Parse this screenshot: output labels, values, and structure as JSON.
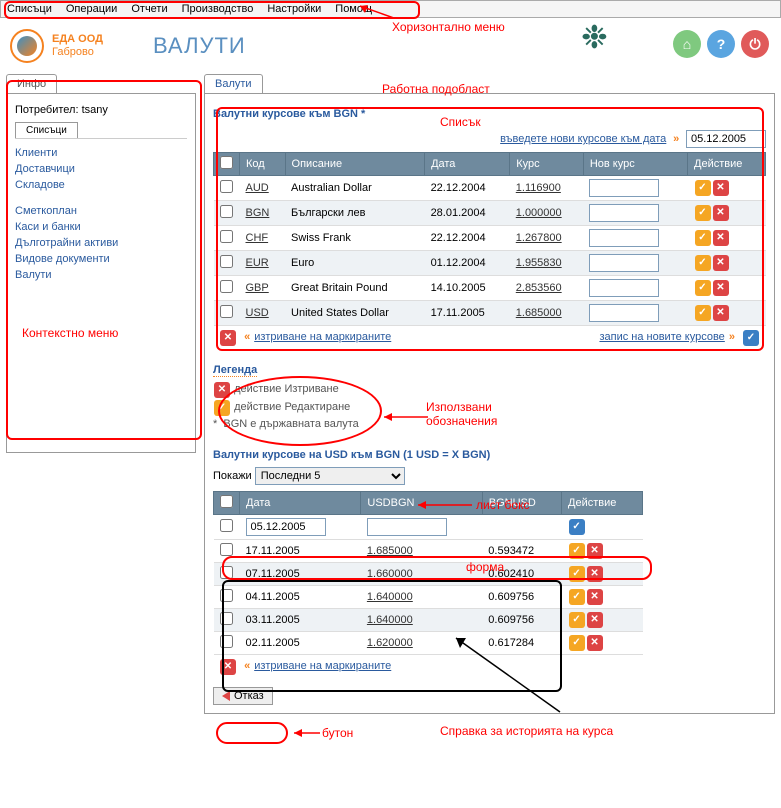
{
  "menu": {
    "items": [
      "Списъци",
      "Операции",
      "Отчети",
      "Производство",
      "Настройки",
      "Помощ"
    ]
  },
  "company": {
    "name": "ЕДА ООД",
    "city": "Габрово"
  },
  "page_title": "ВАЛУТИ",
  "annotations": {
    "horiz_menu": "Хоризонтално меню",
    "work_area": "Работна подобласт",
    "list": "Списък",
    "context_menu": "Контекстно меню",
    "used_legend_1": "Използвани",
    "used_legend_2": "обозначения",
    "listbox": "лист бокс",
    "form": "форма",
    "button": "бутон",
    "history": "Справка за историята на курса"
  },
  "left": {
    "tab": "Инфо",
    "user_label": "Потребител:",
    "user": "tsany",
    "subtab": "Списъци",
    "items1": [
      "Клиенти",
      "Доставчици",
      "Складове"
    ],
    "items2": [
      "Сметкоплан",
      "Каси и банки",
      "Дълготрайни активи",
      "Видове документи",
      "Валути"
    ]
  },
  "main": {
    "tab": "Валути",
    "rates_title": "Валутни курсове към BGN *",
    "enter_new": "въведете нови курсове към дата",
    "date_input": "05.12.2005",
    "cols": {
      "code": "Код",
      "desc": "Описание",
      "date": "Дата",
      "rate": "Курс",
      "newrate": "Нов курс",
      "action": "Действие"
    },
    "rows": [
      {
        "code": "AUD",
        "desc": "Australian Dollar",
        "date": "22.12.2004",
        "rate": "1.116900"
      },
      {
        "code": "BGN",
        "desc": "Български лев",
        "date": "28.01.2004",
        "rate": "1.000000"
      },
      {
        "code": "CHF",
        "desc": "Swiss Frank",
        "date": "22.12.2004",
        "rate": "1.267800"
      },
      {
        "code": "EUR",
        "desc": "Euro",
        "date": "01.12.2004",
        "rate": "1.955830"
      },
      {
        "code": "GBP",
        "desc": "Great Britain Pound",
        "date": "14.10.2005",
        "rate": "2.853560"
      },
      {
        "code": "USD",
        "desc": "United States Dollar",
        "date": "17.11.2005",
        "rate": "1.685000"
      }
    ],
    "delete_marked": "изтриване на маркираните",
    "save_new": "запис на новите курсове",
    "legend": {
      "title": "Легенда",
      "l1": "действие Изтриване",
      "l2": "действие Редактиране",
      "l3": "BGN е държавната валута",
      "star": "*"
    },
    "history": {
      "title": "Валутни курсове на USD към BGN (1 USD = X BGN)",
      "show_label": "Покажи",
      "show_value": "Последни 5",
      "cols": {
        "date": "Дата",
        "usdbgn": "USDBGN",
        "bgnusd": "BGNUSD",
        "action": "Действие"
      },
      "form_date": "05.12.2005",
      "rows": [
        {
          "date": "17.11.2005",
          "usdbgn": "1.685000",
          "bgnusd": "0.593472"
        },
        {
          "date": "07.11.2005",
          "usdbgn": "1.660000",
          "bgnusd": "0.602410"
        },
        {
          "date": "04.11.2005",
          "usdbgn": "1.640000",
          "bgnusd": "0.609756"
        },
        {
          "date": "03.11.2005",
          "usdbgn": "1.640000",
          "bgnusd": "0.609756"
        },
        {
          "date": "02.11.2005",
          "usdbgn": "1.620000",
          "bgnusd": "0.617284"
        }
      ],
      "delete_marked": "изтриване на маркираните",
      "cancel": "Отказ"
    }
  }
}
